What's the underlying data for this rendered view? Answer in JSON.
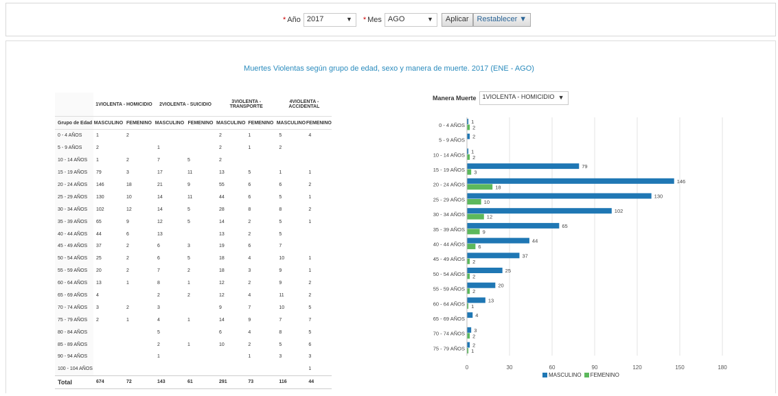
{
  "filters": {
    "year_label": "Año",
    "year_value": "2017",
    "month_label": "Mes",
    "month_value": "AGO",
    "apply_label": "Aplicar",
    "reset_label": "Restablecer ▼"
  },
  "report": {
    "title": "Muertes Violentas según grupo de edad, sexo y manera de muerte. 2017 (ENE - AGO)"
  },
  "table": {
    "group_header": "Grupo de Edad",
    "manners": [
      "1VIOLENTA - HOMICIDIO",
      "2VIOLENTA - SUICIDIO",
      "3VIOLENTA - TRANSPORTE",
      "4VIOLENTA - ACCIDENTAL"
    ],
    "sex_headers": [
      "MASCULINO",
      "FEMENINO"
    ],
    "rows": [
      {
        "group": "0 - 4 AÑOS",
        "values": [
          "1",
          "2",
          "",
          "",
          "2",
          "1",
          "5",
          "4"
        ]
      },
      {
        "group": "5 - 9 AÑOS",
        "values": [
          "2",
          "",
          "1",
          "",
          "2",
          "1",
          "2",
          ""
        ]
      },
      {
        "group": "10 - 14 AÑOS",
        "values": [
          "1",
          "2",
          "7",
          "5",
          "2",
          "",
          "",
          ""
        ]
      },
      {
        "group": "15 - 19 AÑOS",
        "values": [
          "79",
          "3",
          "17",
          "11",
          "13",
          "5",
          "1",
          "1"
        ]
      },
      {
        "group": "20 - 24 AÑOS",
        "values": [
          "146",
          "18",
          "21",
          "9",
          "55",
          "6",
          "6",
          "2"
        ]
      },
      {
        "group": "25 - 29 AÑOS",
        "values": [
          "130",
          "10",
          "14",
          "11",
          "44",
          "6",
          "5",
          "1"
        ]
      },
      {
        "group": "30 - 34 AÑOS",
        "values": [
          "102",
          "12",
          "14",
          "5",
          "28",
          "8",
          "8",
          "2"
        ]
      },
      {
        "group": "35 - 39 AÑOS",
        "values": [
          "65",
          "9",
          "12",
          "5",
          "14",
          "2",
          "5",
          "1"
        ]
      },
      {
        "group": "40 - 44 AÑOS",
        "values": [
          "44",
          "6",
          "13",
          "",
          "13",
          "2",
          "5",
          ""
        ]
      },
      {
        "group": "45 - 49 AÑOS",
        "values": [
          "37",
          "2",
          "6",
          "3",
          "19",
          "6",
          "7",
          ""
        ]
      },
      {
        "group": "50 - 54 AÑOS",
        "values": [
          "25",
          "2",
          "6",
          "5",
          "18",
          "4",
          "10",
          "1"
        ]
      },
      {
        "group": "55 - 59 AÑOS",
        "values": [
          "20",
          "2",
          "7",
          "2",
          "18",
          "3",
          "9",
          "1"
        ]
      },
      {
        "group": "60 - 64 AÑOS",
        "values": [
          "13",
          "1",
          "8",
          "1",
          "12",
          "2",
          "9",
          "2"
        ]
      },
      {
        "group": "65 - 69 AÑOS",
        "values": [
          "4",
          "",
          "2",
          "2",
          "12",
          "4",
          "11",
          "2"
        ]
      },
      {
        "group": "70 - 74 AÑOS",
        "values": [
          "3",
          "2",
          "3",
          "",
          "9",
          "7",
          "10",
          "5"
        ]
      },
      {
        "group": "75 - 79 AÑOS",
        "values": [
          "2",
          "1",
          "4",
          "1",
          "14",
          "9",
          "7",
          "7"
        ]
      },
      {
        "group": "80 - 84 AÑOS",
        "values": [
          "",
          "",
          "5",
          "",
          "6",
          "4",
          "8",
          "5"
        ]
      },
      {
        "group": "85 - 89 AÑOS",
        "values": [
          "",
          "",
          "2",
          "1",
          "10",
          "2",
          "5",
          "6"
        ]
      },
      {
        "group": "90 - 94 AÑOS",
        "values": [
          "",
          "",
          "1",
          "",
          "",
          "1",
          "3",
          "3"
        ]
      },
      {
        "group": "100 - 104 AÑOS",
        "values": [
          "",
          "",
          "",
          "",
          "",
          "",
          "",
          "1"
        ]
      }
    ],
    "total_label": "Total",
    "totals": [
      "674",
      "72",
      "143",
      "61",
      "291",
      "73",
      "116",
      "44"
    ]
  },
  "chart_control": {
    "label": "Manera Muerte",
    "value": "1VIOLENTA - HOMICIDIO"
  },
  "chart_data": {
    "type": "bar",
    "orientation": "horizontal",
    "categories": [
      "0 - 4 AÑOS",
      "5 - 9 AÑOS",
      "10 - 14 AÑOS",
      "15 - 19 AÑOS",
      "20 - 24 AÑOS",
      "25 - 29 AÑOS",
      "30 - 34 AÑOS",
      "35 - 39 AÑOS",
      "40 - 44 AÑOS",
      "45 - 49 AÑOS",
      "50 - 54 AÑOS",
      "55 - 59 AÑOS",
      "60 - 64 AÑOS",
      "65 - 69 AÑOS",
      "70 - 74 AÑOS",
      "75 - 79 AÑOS"
    ],
    "series": [
      {
        "name": "MASCULINO",
        "color": "#1f77b4",
        "values": [
          1,
          2,
          1,
          79,
          146,
          130,
          102,
          65,
          44,
          37,
          25,
          20,
          13,
          4,
          3,
          2
        ]
      },
      {
        "name": "FEMENINO",
        "color": "#5cb85c",
        "values": [
          2,
          null,
          2,
          3,
          18,
          10,
          12,
          9,
          6,
          2,
          2,
          2,
          1,
          null,
          2,
          1
        ]
      }
    ],
    "xlim": [
      0,
      180
    ],
    "xticks": [
      0,
      30,
      60,
      90,
      120,
      150,
      180
    ],
    "grid": true,
    "legend": "bottom"
  }
}
